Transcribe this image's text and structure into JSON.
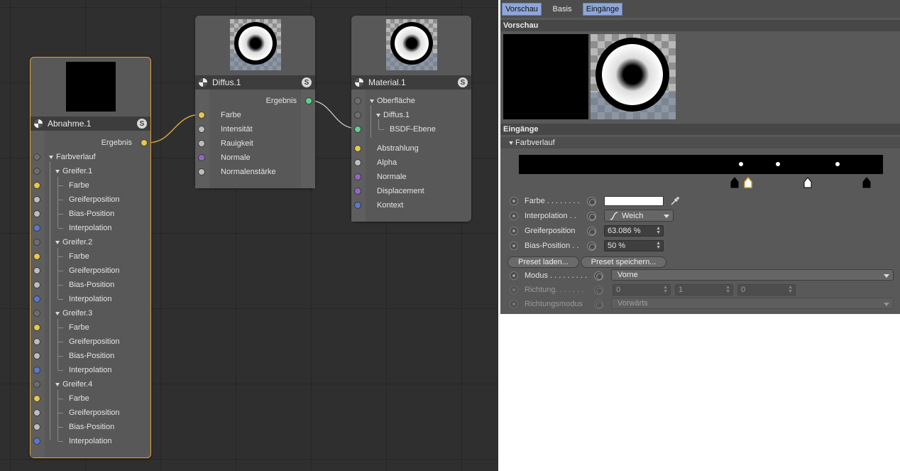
{
  "tabs": [
    "Vorschau",
    "Basis",
    "Eingänge"
  ],
  "sections": {
    "preview": "Vorschau",
    "inputs": "Eingänge",
    "gradient": "Farbverlauf"
  },
  "nodes": {
    "abnahme": {
      "title": "Abnahme.1",
      "output": "Ergebnis",
      "group": "Farbverlauf",
      "knots": [
        {
          "name": "Greifer.1",
          "fields": [
            "Farbe",
            "Greiferposition",
            "Bias-Position",
            "Interpolation"
          ]
        },
        {
          "name": "Greifer.2",
          "fields": [
            "Farbe",
            "Greiferposition",
            "Bias-Position",
            "Interpolation"
          ]
        },
        {
          "name": "Greifer.3",
          "fields": [
            "Farbe",
            "Greiferposition",
            "Bias-Position",
            "Interpolation"
          ]
        },
        {
          "name": "Greifer.4",
          "fields": [
            "Farbe",
            "Greiferposition",
            "Bias-Position",
            "Interpolation"
          ]
        }
      ]
    },
    "diffus": {
      "title": "Diffus.1",
      "output": "Ergebnis",
      "inputs": [
        "Farbe",
        "Intensität",
        "Rauigkeit",
        "Normale",
        "Normalenstärke"
      ]
    },
    "material": {
      "title": "Material.1",
      "tree": [
        "Oberfläche",
        "Diffus.1",
        "BSDF-Ebene"
      ],
      "inputs": [
        "Abstrahlung",
        "Alpha",
        "Normale",
        "Displacement",
        "Kontext"
      ]
    }
  },
  "params": {
    "farbe": {
      "label": "Farbe . . . . . . . .",
      "value": "#ffffff"
    },
    "interpolation": {
      "label": "Interpolation . .",
      "value": "Weich"
    },
    "greiferposition": {
      "label": "Greiferposition",
      "value": "63.086 %"
    },
    "bias": {
      "label": "Bias-Position . .",
      "value": "50 %"
    },
    "preset_load": "Preset laden...",
    "preset_save": "Preset speichern...",
    "modus": {
      "label": "Modus . . . . . . . . .",
      "value": "Vorne"
    },
    "richtung": {
      "label": "Richtung. . . . . . .",
      "values": [
        "0",
        "1",
        "0"
      ]
    },
    "richtungsmodus": {
      "label": "Richtungsmodus",
      "value": "Vorwärts"
    }
  },
  "colors": {
    "selection": "#e3a232",
    "tab_active": "#8fa6d8"
  }
}
